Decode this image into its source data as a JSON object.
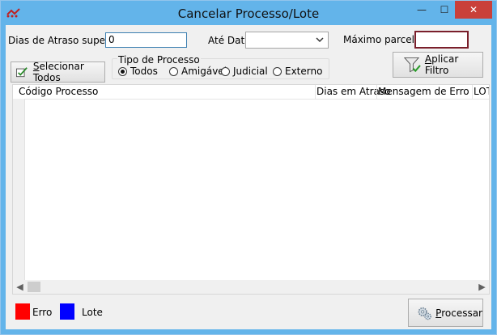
{
  "window": {
    "title": "Cancelar Processo/Lote",
    "controls": {
      "minimize": "—",
      "maximize": "☐",
      "close": "✕"
    }
  },
  "filters": {
    "dias_atraso_label": "Dias de Atraso superior :",
    "dias_atraso_value": "0",
    "ate_data_label": "Até Data",
    "ate_data_value": "",
    "maximo_parcelas_label": "Máximo parcelas :",
    "maximo_parcelas_value": ""
  },
  "actions": {
    "selecionar_todos_prefix": "S",
    "selecionar_todos_rest": "elecionar Todos",
    "aplicar_filtro_prefix": "A",
    "aplicar_filtro_rest": "plicar Filtro",
    "processar_prefix": "P",
    "processar_rest": "rocessar"
  },
  "tipo_processo": {
    "legend": "Tipo de Processo",
    "options": [
      {
        "label": "Todos",
        "selected": true
      },
      {
        "label": "Amigável",
        "selected": false
      },
      {
        "label": "Judicial",
        "selected": false
      },
      {
        "label": "Externo",
        "selected": false
      }
    ]
  },
  "grid": {
    "columns": [
      "Código Processo",
      "Dias em Atraso",
      "Mensagem de Erro",
      "LOTE"
    ],
    "rows": []
  },
  "legend": {
    "items": [
      {
        "label": "Erro",
        "color": "#ff0000"
      },
      {
        "label": "Lote",
        "color": "#0000ff"
      }
    ]
  },
  "colors": {
    "titlebar": "#63b4ea",
    "close_button": "#c9403a",
    "focused_border": "#7a1f2b"
  }
}
